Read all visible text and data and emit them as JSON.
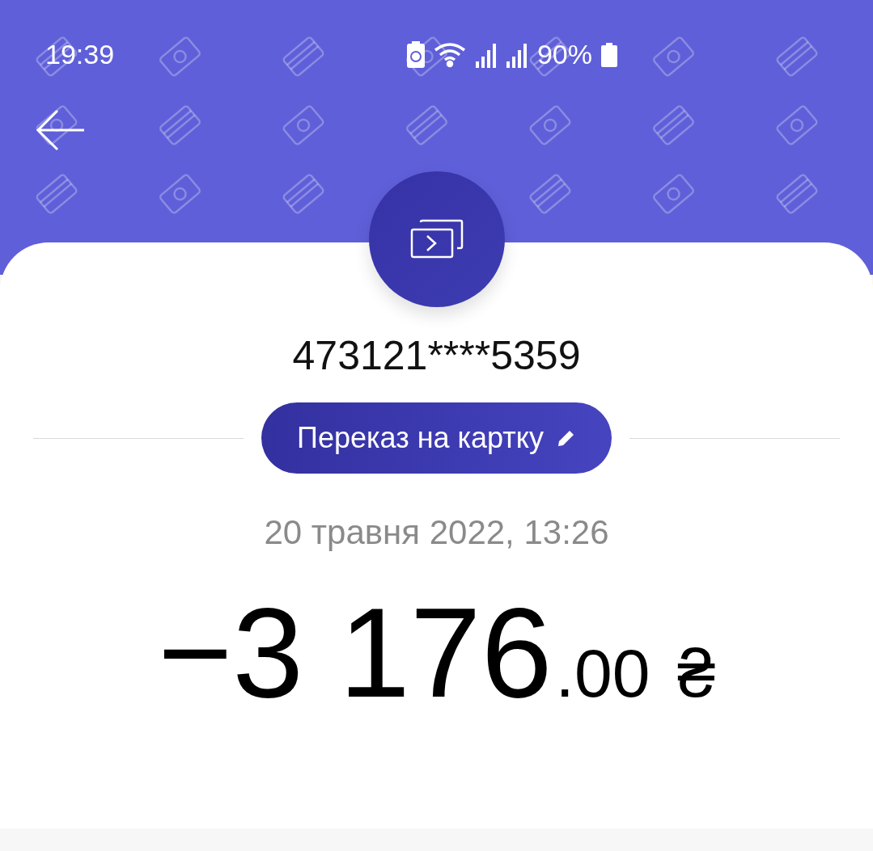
{
  "status_bar": {
    "time": "19:39",
    "battery": "90%"
  },
  "transaction": {
    "card_number": "473121****5359",
    "category": "Переказ на картку",
    "date": "20 травня 2022, 13:26",
    "amount": {
      "integer": "−3 176",
      "fraction": ".00",
      "currency": "₴"
    }
  }
}
